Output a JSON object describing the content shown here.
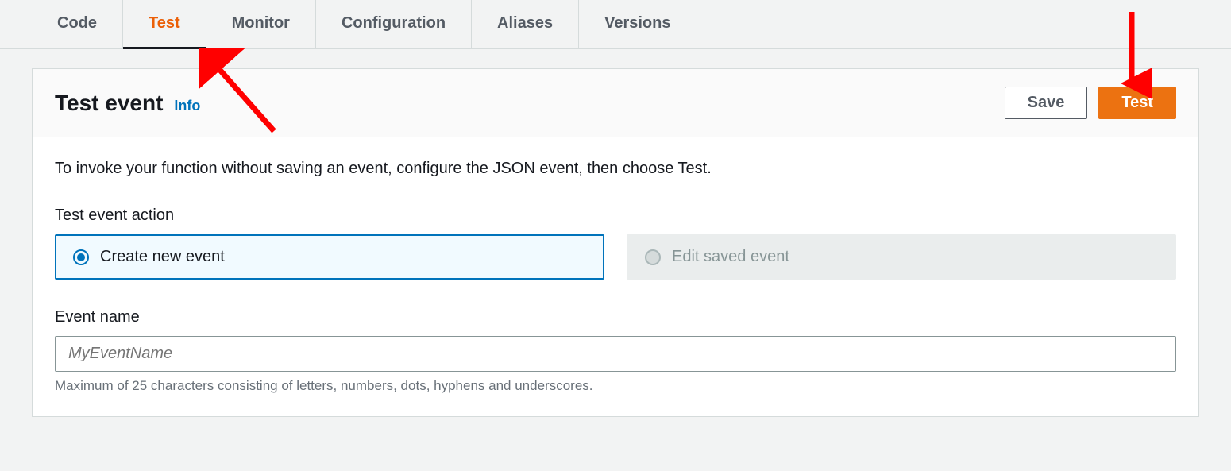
{
  "tabs": [
    {
      "label": "Code",
      "active": false
    },
    {
      "label": "Test",
      "active": true
    },
    {
      "label": "Monitor",
      "active": false
    },
    {
      "label": "Configuration",
      "active": false
    },
    {
      "label": "Aliases",
      "active": false
    },
    {
      "label": "Versions",
      "active": false
    }
  ],
  "panel": {
    "title": "Test event",
    "info_link": "Info",
    "save_button": "Save",
    "test_button": "Test",
    "description": "To invoke your function without saving an event, configure the JSON event, then choose Test.",
    "action_label": "Test event action",
    "radio_create": "Create new event",
    "radio_edit": "Edit saved event",
    "event_name_label": "Event name",
    "event_name_placeholder": "MyEventName",
    "event_name_helper": "Maximum of 25 characters consisting of letters, numbers, dots, hyphens and underscores."
  },
  "colors": {
    "accent_orange": "#ec7211",
    "active_tab_text": "#eb5f07",
    "link_blue": "#0073bb",
    "arrow_red": "#ff0000"
  }
}
